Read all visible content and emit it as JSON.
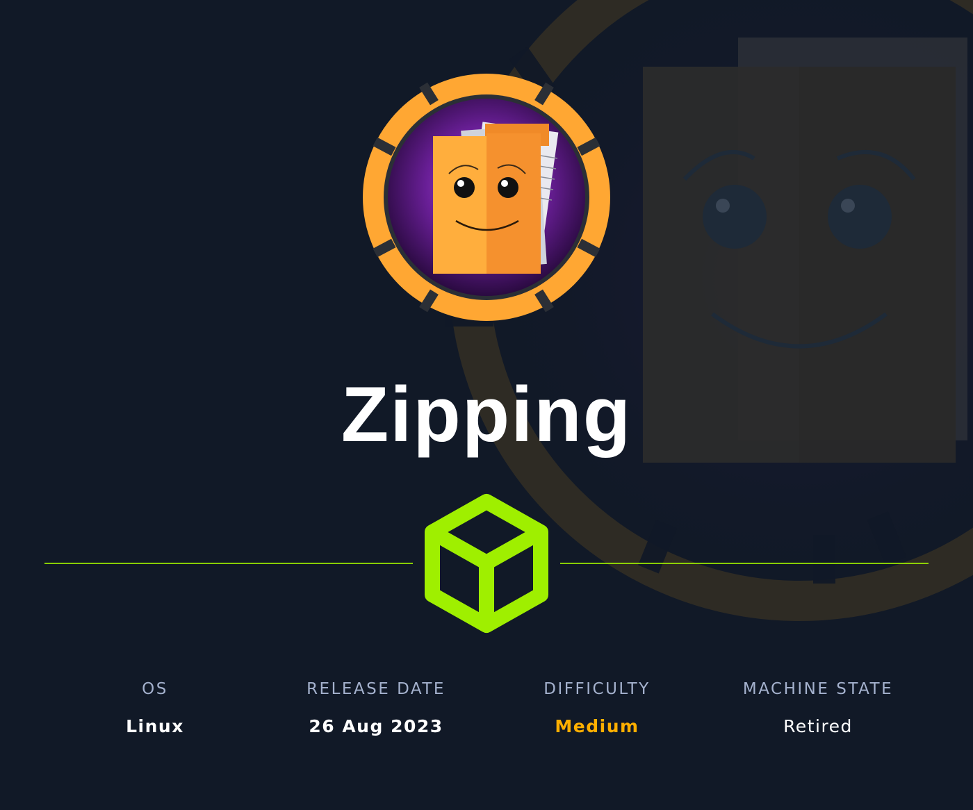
{
  "machine": {
    "name": "Zipping"
  },
  "stats": [
    {
      "label": "OS",
      "value": "Linux"
    },
    {
      "label": "RELEASE DATE",
      "value": "26 Aug 2023"
    },
    {
      "label": "DIFFICULTY",
      "value": "Medium"
    },
    {
      "label": "MACHINE STATE",
      "value": "Retired"
    }
  ],
  "colors": {
    "background": "#111927",
    "accent_green": "#9fef00",
    "difficulty_medium": "#ffaf00",
    "label_gray": "#a4b1cd",
    "badge_orange": "#ffa733",
    "badge_purple": "#4a1272"
  },
  "icons": {
    "avatar": "smiling-folder-icon",
    "divider_center": "cube-icon"
  }
}
